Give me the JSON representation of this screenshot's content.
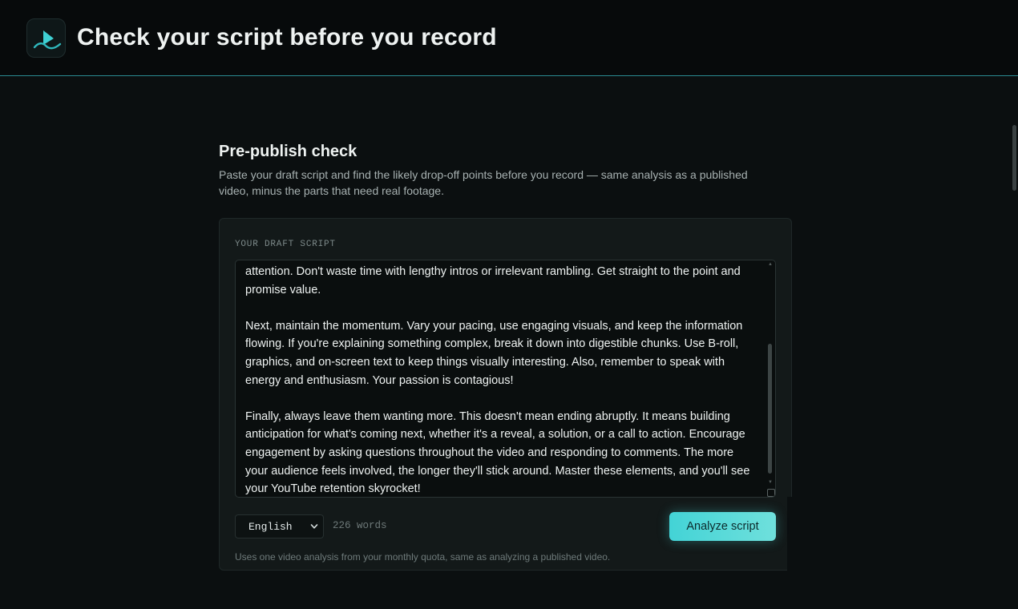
{
  "header": {
    "title": "Check your script before you record",
    "logo_icon": "play-wave-icon"
  },
  "section": {
    "title": "Pre-publish check",
    "description": "Paste your draft script and find the likely drop-off points before you record — same analysis as a published video, minus the parts that need real footage."
  },
  "editor": {
    "label": "YOUR DRAFT SCRIPT",
    "text": "attention. Don't waste time with lengthy intros or irrelevant rambling. Get straight to the point and promise value.\n\nNext, maintain the momentum. Vary your pacing, use engaging visuals, and keep the information flowing. If you're explaining something complex, break it down into digestible chunks. Use B-roll, graphics, and on-screen text to keep things visually interesting. Also, remember to speak with energy and enthusiasm. Your passion is contagious!\n\nFinally, always leave them wanting more. This doesn't mean ending abruptly. It means building anticipation for what's coming next, whether it's a reveal, a solution, or a call to action. Encourage engagement by asking questions throughout the video and responding to comments. The more your audience feels involved, the longer they'll stick around. Master these elements, and you'll see your YouTube retention skyrocket!"
  },
  "controls": {
    "language": "English",
    "word_count": "226 words",
    "analyze_label": "Analyze script"
  },
  "footer": {
    "quota_note": "Uses one video analysis from your monthly quota, same as analyzing a published video."
  },
  "colors": {
    "accent": "#43d3d6",
    "header_border": "#2a8a91",
    "background": "#0b0f10"
  }
}
